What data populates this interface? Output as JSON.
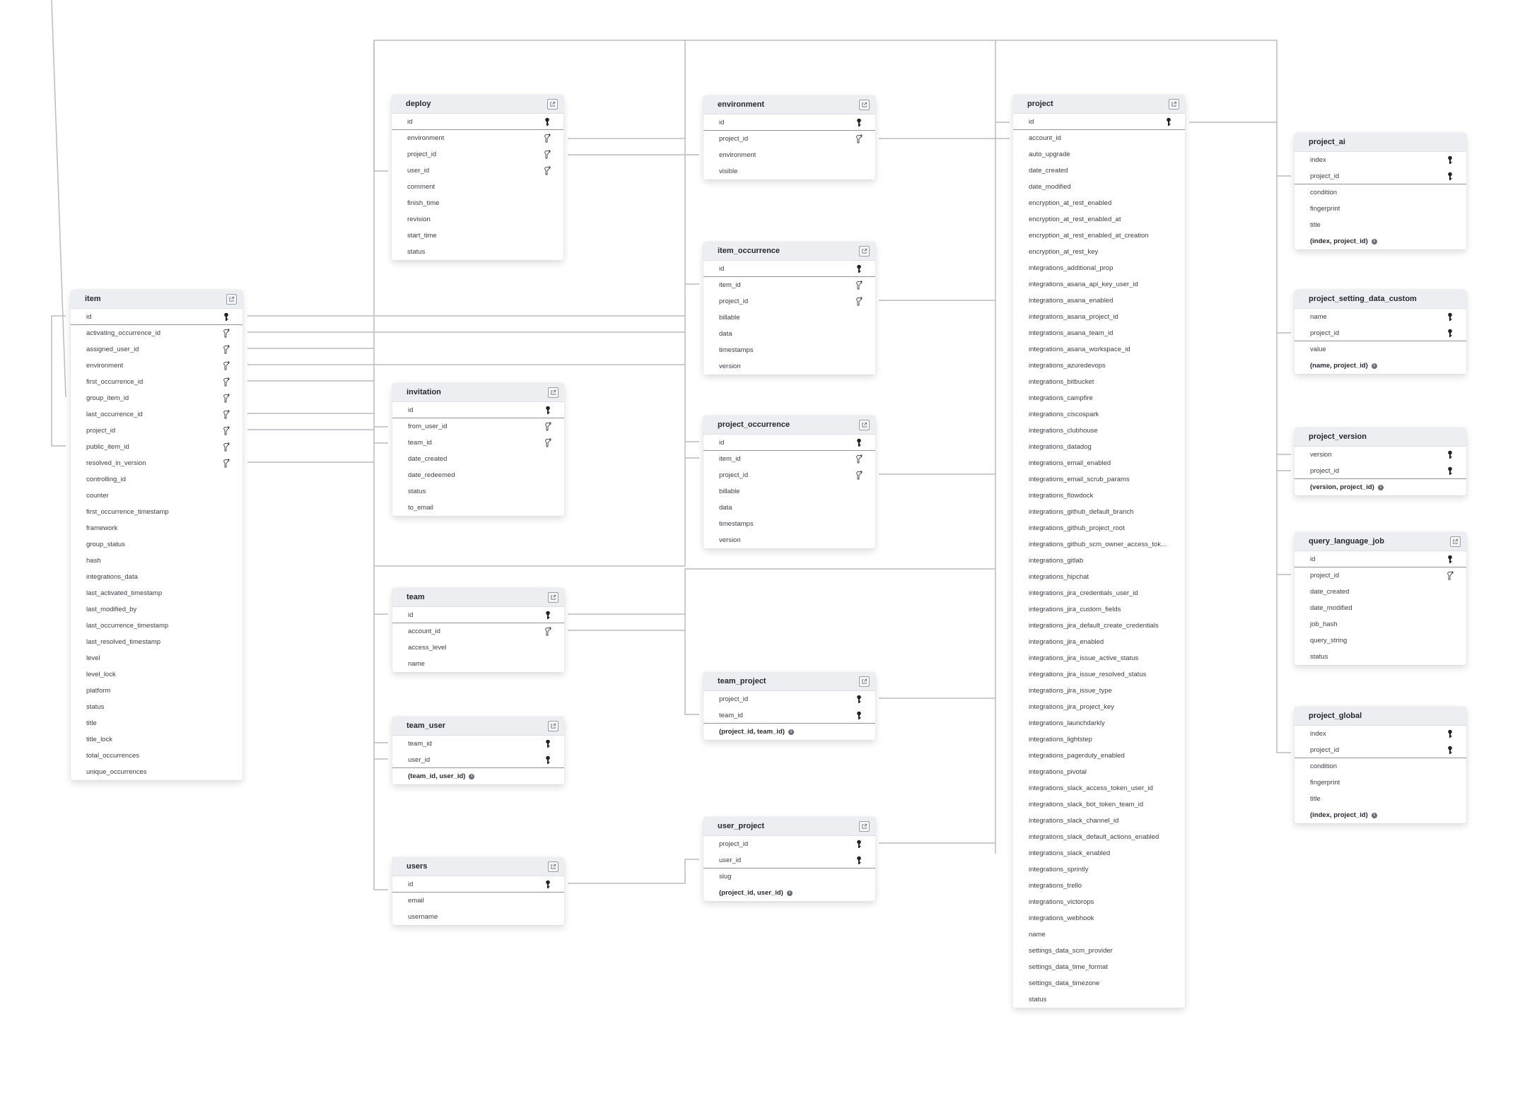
{
  "diagram": {
    "type": "entity-relationship",
    "tables": [
      {
        "id": "item",
        "name": "item",
        "has_link": true,
        "columns": [
          {
            "name": "id",
            "key": "pk",
            "pk_last": true
          },
          {
            "name": "activating_occurrence_id",
            "key": "fk"
          },
          {
            "name": "assigned_user_id",
            "key": "fk"
          },
          {
            "name": "environment",
            "key": "fk"
          },
          {
            "name": "first_occurrence_id",
            "key": "fk"
          },
          {
            "name": "group_item_id",
            "key": "fk"
          },
          {
            "name": "last_occurrence_id",
            "key": "fk"
          },
          {
            "name": "project_id",
            "key": "fk"
          },
          {
            "name": "public_item_id",
            "key": "fk"
          },
          {
            "name": "resolved_in_version",
            "key": "fk"
          },
          {
            "name": "controlling_id"
          },
          {
            "name": "counter"
          },
          {
            "name": "first_occurrence_timestamp"
          },
          {
            "name": "framework"
          },
          {
            "name": "group_status"
          },
          {
            "name": "hash"
          },
          {
            "name": "integrations_data"
          },
          {
            "name": "last_activated_timestamp"
          },
          {
            "name": "last_modified_by"
          },
          {
            "name": "last_occurrence_timestamp"
          },
          {
            "name": "last_resolved_timestamp"
          },
          {
            "name": "level"
          },
          {
            "name": "level_lock"
          },
          {
            "name": "platform"
          },
          {
            "name": "status"
          },
          {
            "name": "title"
          },
          {
            "name": "title_lock"
          },
          {
            "name": "total_occurrences"
          },
          {
            "name": "unique_occurrences"
          }
        ]
      },
      {
        "id": "deploy",
        "name": "deploy",
        "has_link": true,
        "columns": [
          {
            "name": "id",
            "key": "pk",
            "pk_last": true
          },
          {
            "name": "environment",
            "key": "fk"
          },
          {
            "name": "project_id",
            "key": "fk"
          },
          {
            "name": "user_id",
            "key": "fk"
          },
          {
            "name": "comment"
          },
          {
            "name": "finish_time"
          },
          {
            "name": "revision"
          },
          {
            "name": "start_time"
          },
          {
            "name": "status"
          }
        ]
      },
      {
        "id": "environment",
        "name": "environment",
        "has_link": true,
        "columns": [
          {
            "name": "id",
            "key": "pk",
            "pk_last": true
          },
          {
            "name": "project_id",
            "key": "fk"
          },
          {
            "name": "environment"
          },
          {
            "name": "visible"
          }
        ]
      },
      {
        "id": "item_occurrence",
        "name": "item_occurrence",
        "has_link": true,
        "columns": [
          {
            "name": "id",
            "key": "pk",
            "pk_last": true
          },
          {
            "name": "item_id",
            "key": "fk"
          },
          {
            "name": "project_id",
            "key": "fk"
          },
          {
            "name": "billable"
          },
          {
            "name": "data"
          },
          {
            "name": "timestamps"
          },
          {
            "name": "version"
          }
        ]
      },
      {
        "id": "project_occurrence",
        "name": "project_occurrence",
        "has_link": true,
        "columns": [
          {
            "name": "id",
            "key": "pk",
            "pk_last": true
          },
          {
            "name": "item_id",
            "key": "fk"
          },
          {
            "name": "project_id",
            "key": "fk"
          },
          {
            "name": "billable"
          },
          {
            "name": "data"
          },
          {
            "name": "timestamps"
          },
          {
            "name": "version"
          }
        ]
      },
      {
        "id": "invitation",
        "name": "invitation",
        "has_link": true,
        "columns": [
          {
            "name": "id",
            "key": "pk",
            "pk_last": true
          },
          {
            "name": "from_user_id",
            "key": "fk"
          },
          {
            "name": "team_id",
            "key": "fk"
          },
          {
            "name": "date_created"
          },
          {
            "name": "date_redeemed"
          },
          {
            "name": "status"
          },
          {
            "name": "to_email"
          }
        ]
      },
      {
        "id": "team",
        "name": "team",
        "has_link": true,
        "columns": [
          {
            "name": "id",
            "key": "pk",
            "pk_last": true
          },
          {
            "name": "account_id",
            "key": "fk"
          },
          {
            "name": "access_level"
          },
          {
            "name": "name"
          }
        ]
      },
      {
        "id": "team_user",
        "name": "team_user",
        "has_link": true,
        "columns": [
          {
            "name": "team_id",
            "key": "pk"
          },
          {
            "name": "user_id",
            "key": "pk",
            "pk_last": true
          },
          {
            "name": "(team_id, user_id)",
            "composite": true
          }
        ]
      },
      {
        "id": "users",
        "name": "users",
        "has_link": true,
        "columns": [
          {
            "name": "id",
            "key": "pk",
            "pk_last": true
          },
          {
            "name": "email"
          },
          {
            "name": "username"
          }
        ]
      },
      {
        "id": "team_project",
        "name": "team_project",
        "has_link": true,
        "columns": [
          {
            "name": "project_id",
            "key": "pk"
          },
          {
            "name": "team_id",
            "key": "pk",
            "pk_last": true
          },
          {
            "name": "(project_id, team_id)",
            "composite": true
          }
        ]
      },
      {
        "id": "user_project",
        "name": "user_project",
        "has_link": true,
        "columns": [
          {
            "name": "project_id",
            "key": "pk"
          },
          {
            "name": "user_id",
            "key": "pk",
            "pk_last": true
          },
          {
            "name": "slug"
          },
          {
            "name": "(project_id, user_id)",
            "composite": true
          }
        ]
      },
      {
        "id": "project",
        "name": "project",
        "has_link": true,
        "columns": [
          {
            "name": "id",
            "key": "pk",
            "pk_last": true
          },
          {
            "name": "account_id"
          },
          {
            "name": "auto_upgrade"
          },
          {
            "name": "date_created"
          },
          {
            "name": "date_modified"
          },
          {
            "name": "encryption_at_rest_enabled"
          },
          {
            "name": "encryption_at_rest_enabled_at"
          },
          {
            "name": "encryption_at_rest_enabled_at_creation"
          },
          {
            "name": "encryption_at_rest_key"
          },
          {
            "name": "integrations_additional_prop"
          },
          {
            "name": "integrations_asana_api_key_user_id"
          },
          {
            "name": "integrations_asana_enabled"
          },
          {
            "name": "integrations_asana_project_id"
          },
          {
            "name": "integrations_asana_team_id"
          },
          {
            "name": "integrations_asana_workspace_id"
          },
          {
            "name": "integrations_azuredevops"
          },
          {
            "name": "integrations_bitbucket"
          },
          {
            "name": "integrations_campfire"
          },
          {
            "name": "integrations_ciscospark"
          },
          {
            "name": "integrations_clubhouse"
          },
          {
            "name": "integrations_datadog"
          },
          {
            "name": "integrations_email_enabled"
          },
          {
            "name": "integrations_email_scrub_params"
          },
          {
            "name": "integrations_flowdock"
          },
          {
            "name": "integrations_github_default_branch"
          },
          {
            "name": "integrations_github_project_root"
          },
          {
            "name": "integrations_github_scm_owner_access_tok..."
          },
          {
            "name": "integrations_gitlab"
          },
          {
            "name": "integrations_hipchat"
          },
          {
            "name": "integrations_jira_credentials_user_id"
          },
          {
            "name": "integrations_jira_custom_fields"
          },
          {
            "name": "integrations_jira_default_create_credentials"
          },
          {
            "name": "integrations_jira_enabled"
          },
          {
            "name": "integrations_jira_issue_active_status"
          },
          {
            "name": "integrations_jira_issue_resolved_status"
          },
          {
            "name": "integrations_jira_issue_type"
          },
          {
            "name": "integrations_jira_project_key"
          },
          {
            "name": "integrations_launchdarkly"
          },
          {
            "name": "integrations_lightstep"
          },
          {
            "name": "integrations_pagerduty_enabled"
          },
          {
            "name": "integrations_pivotal"
          },
          {
            "name": "integrations_slack_access_token_user_id"
          },
          {
            "name": "integrations_slack_bot_token_team_id"
          },
          {
            "name": "integrations_slack_channel_id"
          },
          {
            "name": "integrations_slack_default_actions_enabled"
          },
          {
            "name": "integrations_slack_enabled"
          },
          {
            "name": "integrations_sprintly"
          },
          {
            "name": "integrations_trello"
          },
          {
            "name": "integrations_victorops"
          },
          {
            "name": "integrations_webhook"
          },
          {
            "name": "name"
          },
          {
            "name": "settings_data_scm_provider"
          },
          {
            "name": "settings_data_time_format"
          },
          {
            "name": "settings_data_timezone"
          },
          {
            "name": "status"
          }
        ]
      },
      {
        "id": "project_ai",
        "name": "project_ai",
        "has_link": false,
        "columns": [
          {
            "name": "index",
            "key": "pk"
          },
          {
            "name": "project_id",
            "key": "pk",
            "pk_last": true
          },
          {
            "name": "condition"
          },
          {
            "name": "fingerprint"
          },
          {
            "name": "title"
          },
          {
            "name": "(index, project_id)",
            "composite": true
          }
        ]
      },
      {
        "id": "project_setting_data_custom",
        "name": "project_setting_data_custom",
        "has_link": false,
        "columns": [
          {
            "name": "name",
            "key": "pk"
          },
          {
            "name": "project_id",
            "key": "pk",
            "pk_last": true
          },
          {
            "name": "value"
          },
          {
            "name": "(name, project_id)",
            "composite": true
          }
        ]
      },
      {
        "id": "project_version",
        "name": "project_version",
        "has_link": false,
        "columns": [
          {
            "name": "version",
            "key": "pk"
          },
          {
            "name": "project_id",
            "key": "pk",
            "pk_last": true
          },
          {
            "name": "(version, project_id)",
            "composite": true
          }
        ]
      },
      {
        "id": "query_language_job",
        "name": "query_language_job",
        "has_link": true,
        "columns": [
          {
            "name": "id",
            "key": "pk",
            "pk_last": true
          },
          {
            "name": "project_id",
            "key": "fk"
          },
          {
            "name": "date_created"
          },
          {
            "name": "date_modified"
          },
          {
            "name": "job_hash"
          },
          {
            "name": "query_string"
          },
          {
            "name": "status"
          }
        ]
      },
      {
        "id": "project_global",
        "name": "project_global",
        "has_link": false,
        "columns": [
          {
            "name": "index",
            "key": "pk"
          },
          {
            "name": "project_id",
            "key": "pk",
            "pk_last": true
          },
          {
            "name": "condition"
          },
          {
            "name": "fingerprint"
          },
          {
            "name": "title"
          },
          {
            "name": "(index, project_id)",
            "composite": true
          }
        ]
      }
    ]
  }
}
